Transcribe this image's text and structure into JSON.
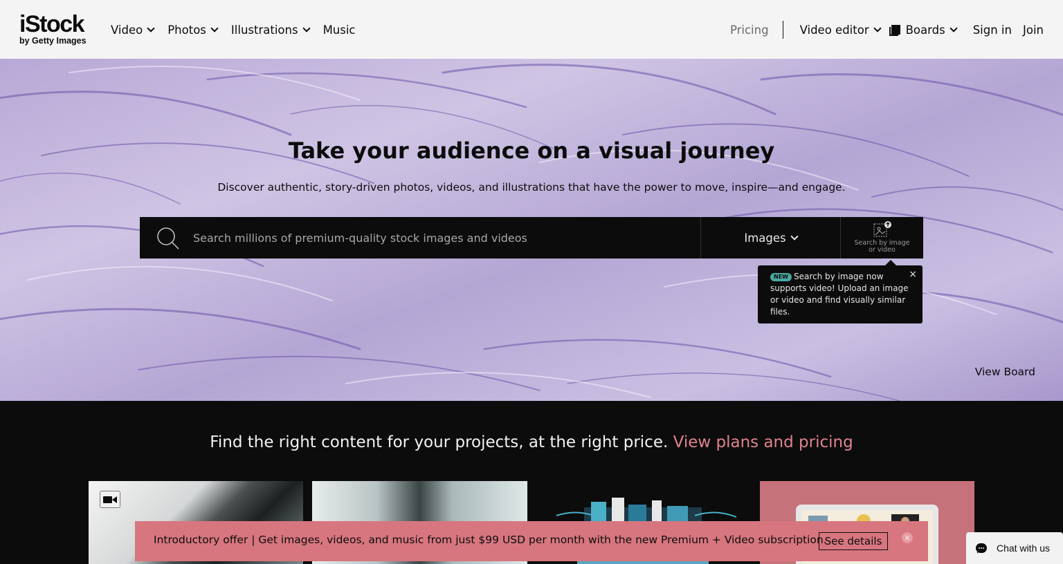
{
  "header": {
    "logo_main": "iStock",
    "logo_sub": "by Getty Images",
    "nav_left": [
      "Video",
      "Photos",
      "Illustrations",
      "Music"
    ],
    "pricing": "Pricing",
    "video_editor": "Video editor",
    "boards": "Boards",
    "sign_in": "Sign in",
    "join": "Join"
  },
  "hero": {
    "title": "Take your audience on a visual journey",
    "subtitle": "Discover authentic, story-driven photos, videos, and illustrations that have the power to move, inspire—and engage.",
    "search_placeholder": "Search millions of premium-quality stock images and videos",
    "search_type": "Images",
    "search_by_image_label": "Search by image or video",
    "tooltip_badge": "NEW",
    "tooltip_text": "Search by image now supports video! Upload an image or video and find visually similar files.",
    "tooltip_close": "×",
    "view_board": "View Board",
    "bg_color": "#b8a8d6"
  },
  "promo": {
    "text": "Find the right content for your projects, at the right price.",
    "link": "View plans and pricing",
    "link_color": "#e0838d"
  },
  "banner": {
    "text": "Introductory offer | Get images, videos, and music from just $99 USD per month with the new Premium + Video subscription.",
    "button": "See details",
    "close": "×",
    "bg_color": "#d7767f"
  },
  "chat": {
    "label": "Chat with us"
  },
  "icons": [
    "search-icon",
    "chevron-down-icon",
    "board-icon",
    "search-by-image-icon",
    "close-icon",
    "video-camera-icon",
    "chat-icon"
  ]
}
